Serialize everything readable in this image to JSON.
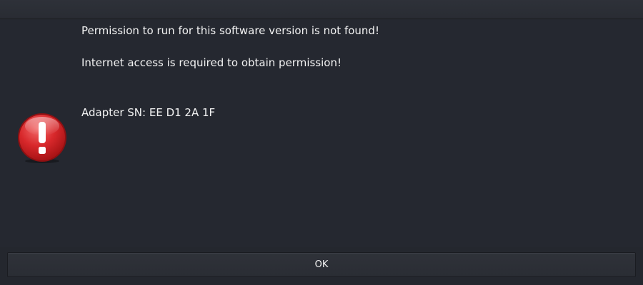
{
  "dialog": {
    "messages": [
      "Permission to run for this software version is not found!",
      "Internet access is required to obtain permission!",
      "Adapter SN: EE D1 2A 1F"
    ],
    "icon": "error-exclamation-icon",
    "ok_label": "OK"
  },
  "colors": {
    "background": "#252830",
    "icon_red": "#d8282b",
    "text": "#f2f2f2"
  }
}
